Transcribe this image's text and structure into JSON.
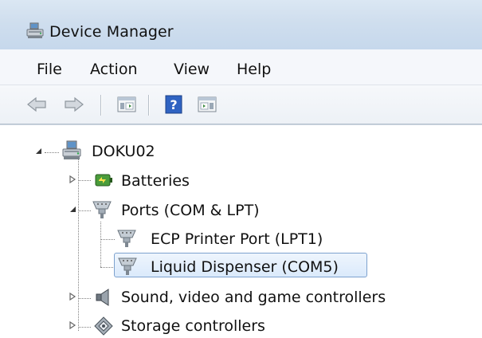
{
  "window": {
    "title": "Device Manager",
    "app_icon": "device-manager-icon"
  },
  "menu": [
    {
      "label": "File"
    },
    {
      "label": "Action"
    },
    {
      "label": "View"
    },
    {
      "label": "Help"
    }
  ],
  "toolbar": {
    "buttons": [
      "back-arrow-icon",
      "forward-arrow-icon",
      "properties-icon",
      "help-icon",
      "console-tree-icon"
    ]
  },
  "tree": {
    "root": {
      "label": "DOKU02",
      "icon": "computer-icon",
      "expanded": true
    },
    "items": [
      {
        "label": "Batteries",
        "icon": "battery-icon",
        "expanded": false
      },
      {
        "label": "Ports (COM & LPT)",
        "icon": "port-icon",
        "expanded": true,
        "children": [
          {
            "label": "ECP Printer Port (LPT1)",
            "icon": "port-icon"
          },
          {
            "label": "Liquid Dispenser (COM5)",
            "icon": "port-icon",
            "selected": true
          }
        ]
      },
      {
        "label": "Sound, video and game controllers",
        "icon": "speaker-icon",
        "expanded": false
      },
      {
        "label": "Storage controllers",
        "icon": "storage-icon",
        "expanded": false
      }
    ]
  },
  "colors": {
    "selection_border": "#7da2ce",
    "titlebar": "#cfdeee"
  }
}
